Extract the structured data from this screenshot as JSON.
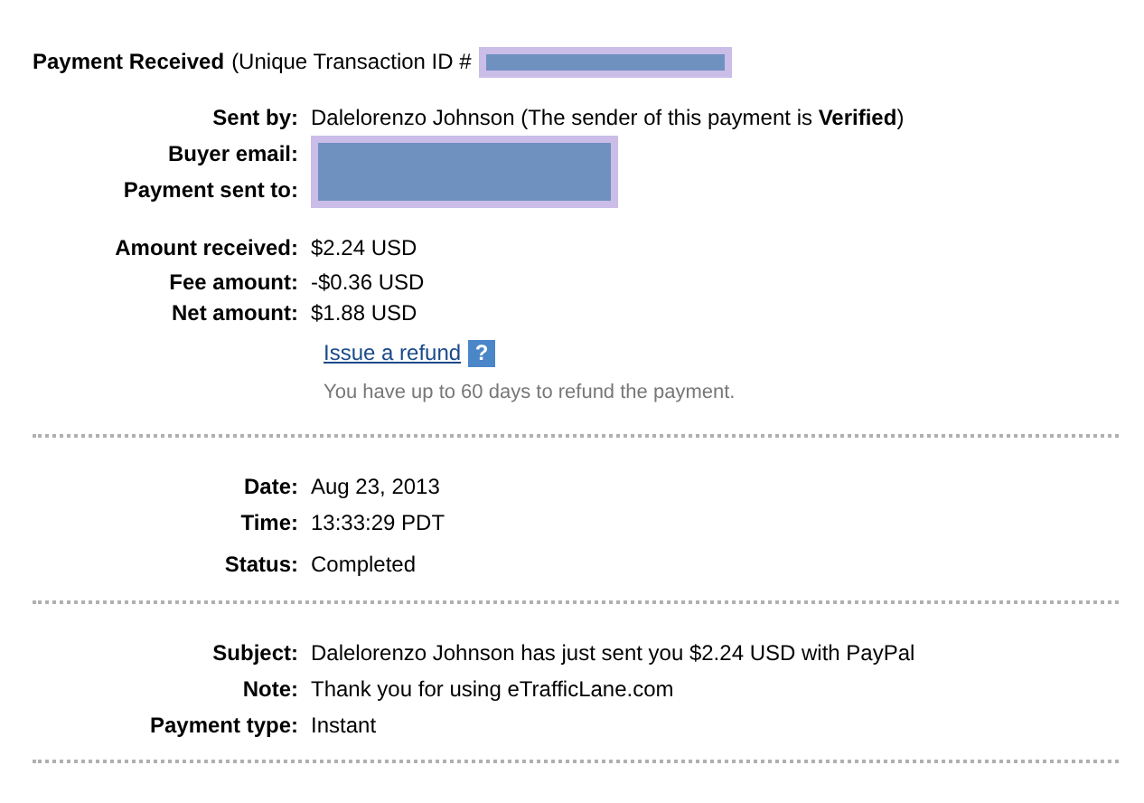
{
  "header": {
    "title": "Payment Received",
    "subtitle": "(Unique Transaction ID #"
  },
  "parties": {
    "sent_by": {
      "label": "Sent by:",
      "value": "Dalelorenzo Johnson (The sender of this payment is **Verified**)"
    },
    "redacted_labels": [
      "Buyer email:",
      "Payment sent to:"
    ]
  },
  "amounts": [
    {
      "label": "Amount received:",
      "value": "$2.24 USD"
    },
    {
      "label": "Fee amount:",
      "value": "-$0.36 USD"
    },
    {
      "label": "Net amount:",
      "value": "$1.88 USD"
    }
  ],
  "refund": {
    "link": "Issue a refund",
    "help": "?",
    "note": "You have up to 60 days to refund the payment."
  },
  "details": [
    {
      "label": "Date:",
      "value": "Aug 23, 2013"
    },
    {
      "label": "Time:",
      "value": "13:33:29 PDT"
    },
    {
      "label": "Status:",
      "value": "Completed"
    }
  ],
  "message": [
    {
      "label": "Subject:",
      "value": "Dalelorenzo Johnson has just sent you $2.24 USD with PayPal"
    },
    {
      "label": "Note:",
      "value": "Thank you for using eTrafficLane.com"
    },
    {
      "label": "Payment type:",
      "value": "Instant"
    }
  ]
}
